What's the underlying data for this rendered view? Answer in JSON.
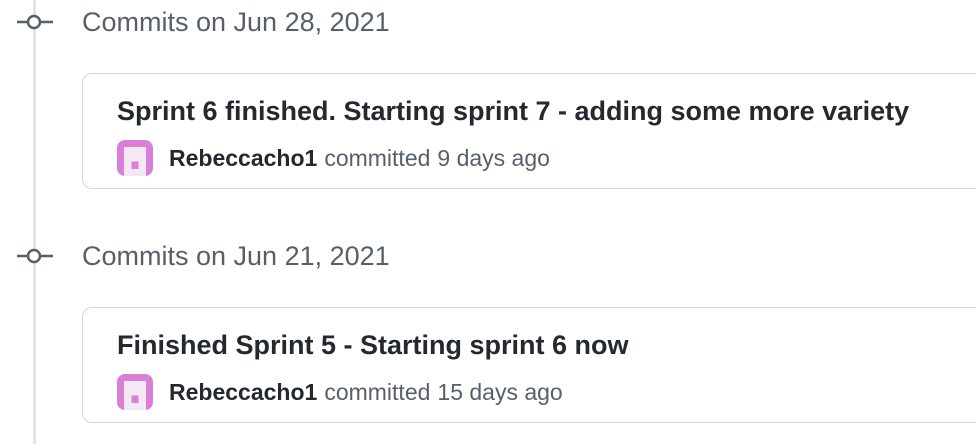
{
  "timeline": {
    "groups": [
      {
        "date_label": "Commits on Jun 28, 2021",
        "commit": {
          "title": "Sprint 6 finished. Starting sprint 7 - adding some more variety",
          "author": "Rebeccacho1",
          "action": "committed",
          "age": "9 days ago"
        }
      },
      {
        "date_label": "Commits on Jun 21, 2021",
        "commit": {
          "title": "Finished Sprint 5 - Starting sprint 6 now",
          "author": "Rebeccacho1",
          "action": "committed",
          "age": "15 days ago"
        }
      }
    ]
  },
  "icons": {
    "commit_node": "git-commit-icon",
    "avatar": "identicon-avatar"
  },
  "colors": {
    "avatar": "#d97fd6",
    "timeline": "#e1e4e8",
    "muted_text": "#57606a",
    "card_border": "#d0d7de"
  }
}
